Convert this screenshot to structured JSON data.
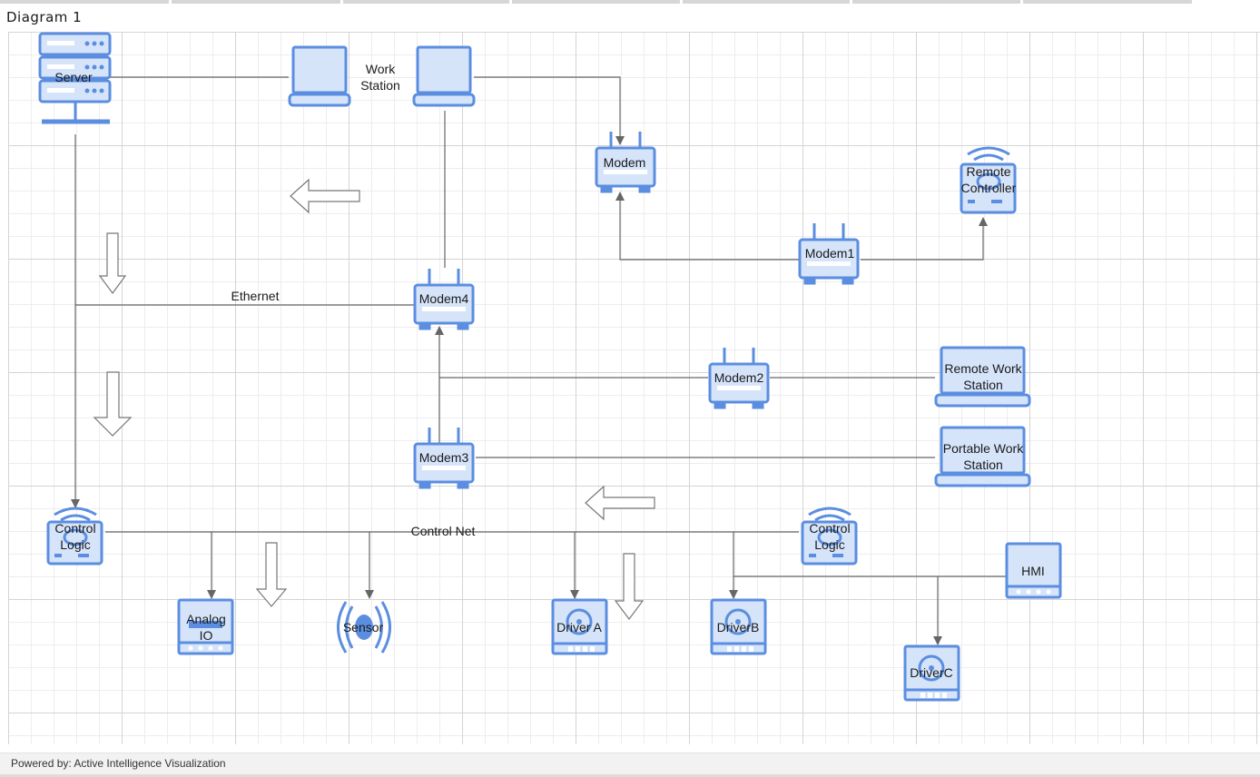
{
  "window": {
    "title": "Diagram 1"
  },
  "footer": {
    "text": "Powered by: Active Intelligence Visualization"
  },
  "colors": {
    "icon_fill": "#d6e4fa",
    "icon_stroke": "#5b8ee0",
    "line": "#666666",
    "grid": "#d4d4d4"
  },
  "nodes": {
    "server": {
      "label": "Server",
      "icon": "server-icon"
    },
    "workstation_a": {
      "label": "",
      "icon": "laptop-icon"
    },
    "workstation_b": {
      "label": "",
      "icon": "laptop-icon"
    },
    "modem": {
      "label": "Modem",
      "icon": "router-icon"
    },
    "remote_controller": {
      "label": "Remote\nController",
      "icon": "wireless-controller-icon"
    },
    "modem1": {
      "label": "Modem1",
      "icon": "router-icon"
    },
    "modem4": {
      "label": "Modem4",
      "icon": "router-icon"
    },
    "modem2": {
      "label": "Modem2",
      "icon": "router-icon"
    },
    "remote_work_station": {
      "label": "Remote Work\nStation",
      "icon": "laptop-icon"
    },
    "modem3": {
      "label": "Modem3",
      "icon": "router-icon"
    },
    "portable_work_station": {
      "label": "Portable Work\nStation",
      "icon": "laptop-icon"
    },
    "control_logic_a": {
      "label": "Control\nLogic",
      "icon": "wireless-controller-icon"
    },
    "control_logic_b": {
      "label": "Control\nLogic",
      "icon": "wireless-controller-icon"
    },
    "hmi": {
      "label": "HMI",
      "icon": "hmi-panel-icon"
    },
    "analog_io": {
      "label": "Analog\nIO",
      "icon": "io-module-icon"
    },
    "sensor": {
      "label": "Sensor",
      "icon": "sensor-icon"
    },
    "driver_a": {
      "label": "Driver A",
      "icon": "drive-icon"
    },
    "driver_b": {
      "label": "DriverB",
      "icon": "drive-icon"
    },
    "driver_c": {
      "label": "DriverC",
      "icon": "drive-icon"
    }
  },
  "edge_labels": {
    "work_station": "Work\nStation",
    "ethernet": "Ethernet",
    "control_net": "Control Net"
  },
  "connections": [
    {
      "from": "server",
      "to": "workstation_a"
    },
    {
      "from": "workstation_b",
      "to": "modem"
    },
    {
      "from": "workstation_b",
      "to": "modem4"
    },
    {
      "from": "modem1",
      "to": "modem"
    },
    {
      "from": "modem1",
      "to": "remote_controller"
    },
    {
      "from": "server",
      "to": "modem4",
      "label": "Ethernet"
    },
    {
      "from": "server",
      "to": "control_logic_a"
    },
    {
      "from": "modem2",
      "to": "modem4"
    },
    {
      "from": "modem2",
      "to": "remote_work_station"
    },
    {
      "from": "modem3",
      "to": "modem4"
    },
    {
      "from": "modem3",
      "to": "portable_work_station"
    },
    {
      "from": "control_logic_a",
      "to": "control_logic_b",
      "label": "Control Net"
    },
    {
      "from": "control_logic_a",
      "to": "analog_io"
    },
    {
      "from": "control_logic_a",
      "to": "sensor"
    },
    {
      "from": "control_logic_a",
      "to": "driver_a"
    },
    {
      "from": "control_logic_a",
      "to": "driver_b"
    },
    {
      "from": "hmi",
      "to": "driver_b"
    },
    {
      "from": "hmi",
      "to": "driver_c"
    }
  ],
  "flow_arrows": [
    {
      "direction": "left"
    },
    {
      "direction": "down"
    },
    {
      "direction": "down"
    },
    {
      "direction": "left"
    },
    {
      "direction": "down"
    },
    {
      "direction": "down"
    }
  ]
}
